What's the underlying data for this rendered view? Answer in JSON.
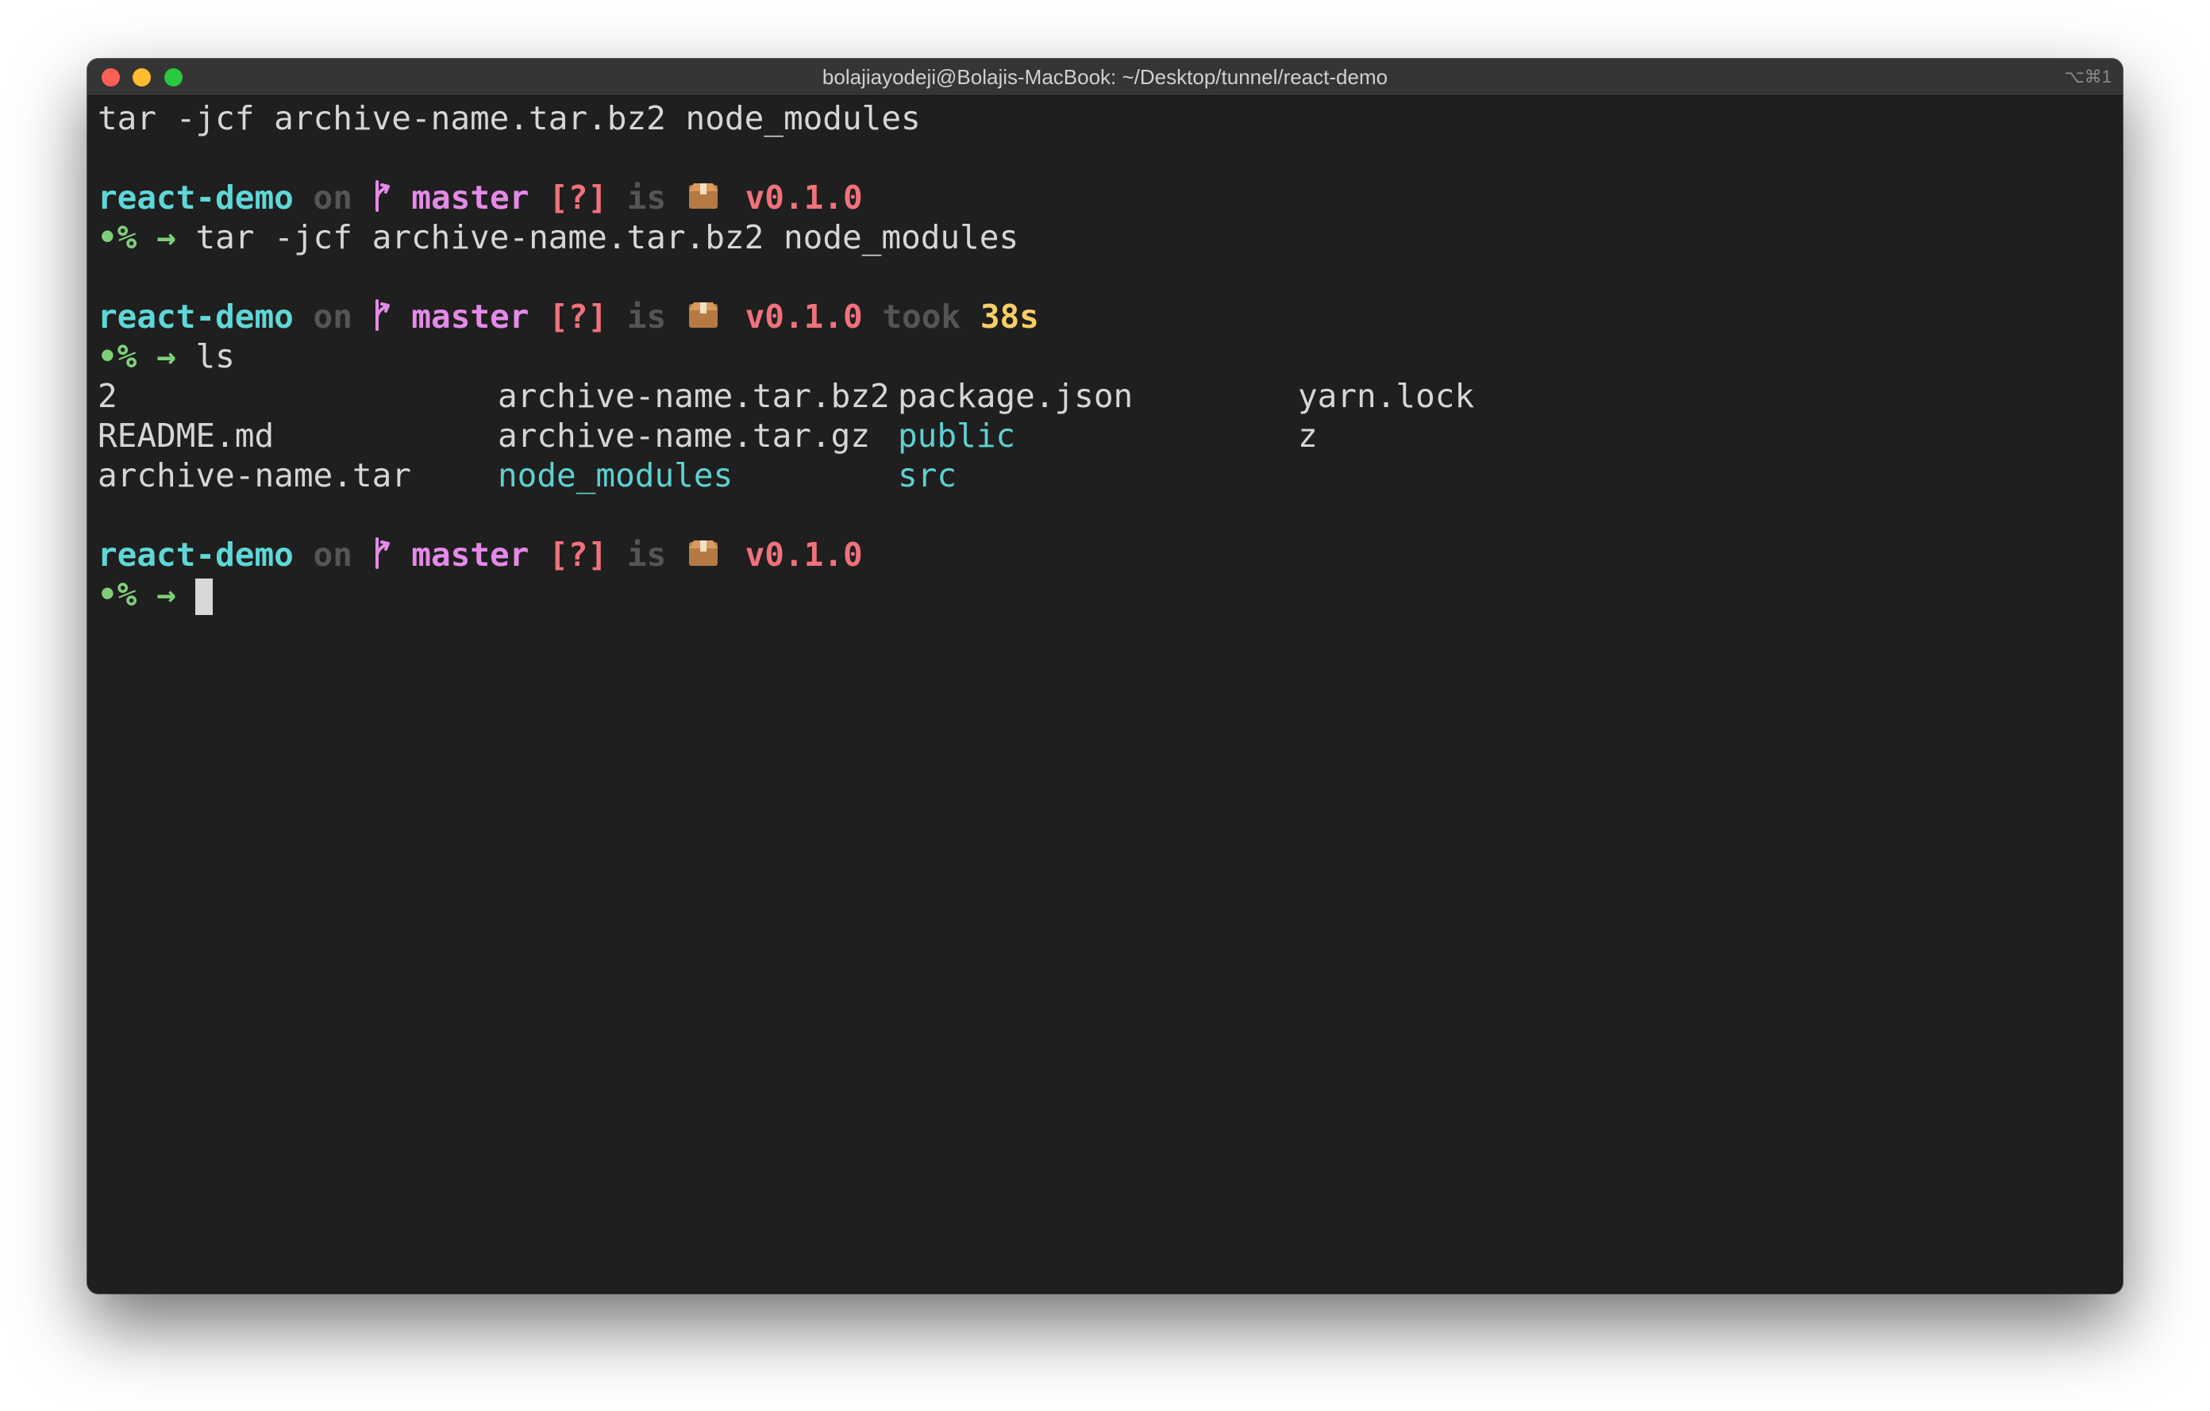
{
  "window": {
    "title": "bolajiayodeji@Bolajis-MacBook: ~/Desktop/tunnel/react-demo",
    "shortcut": "⌥⌘1"
  },
  "terminal": {
    "first_line": "tar -jcf archive-name.tar.bz2 node_modules",
    "prompt": {
      "dir": "react-demo",
      "on": "on",
      "branch": "master",
      "status": "[?]",
      "is": "is",
      "version": "v0.1.0",
      "took": "took",
      "duration": "38s",
      "symbol": "•% →"
    },
    "commands": [
      "tar -jcf archive-name.tar.bz2 node_modules",
      "ls"
    ],
    "ls_output": [
      [
        "2",
        "archive-name.tar.bz2",
        "package.json",
        "yarn.lock"
      ],
      [
        "README.md",
        "archive-name.tar.gz",
        "public",
        "z"
      ],
      [
        "archive-name.tar",
        "node_modules",
        "src",
        ""
      ]
    ],
    "colors": {
      "background": "#1f1f1f",
      "dir": "#5fd7d7",
      "branch": "#e48ae8",
      "status": "#f0727a",
      "duration": "#f8cf66",
      "prompt_symbol": "#7fcf7a"
    }
  }
}
